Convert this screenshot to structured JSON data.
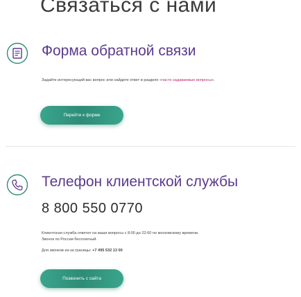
{
  "page_title": "Связаться с нами",
  "feedback": {
    "title": "Форма обратной связи",
    "text_before": "Задайте интересующий вас вопрос или найдите ответ в разделе «",
    "faq_link": "часто задаваемые вопросы",
    "text_after": "».",
    "button": "Перейти к форме"
  },
  "support": {
    "title": "Телефон клиентской службы",
    "phone": "8 800 550 0770",
    "hours_text": "Клиентская служба ответит на ваши вопросы с 8:00 до 22:00 по московскому времени.",
    "free_text": "Звонок по России бесплатный.",
    "abroad_label": "Для звонков из-за границы:",
    "abroad_phone": "+7 495 532 13 00",
    "button": "Позвонить с сайта"
  },
  "colors": {
    "accent": "#5b3b8c",
    "button": "#2e8c77",
    "link": "#c0246f"
  },
  "icons": {
    "feedback": "form-icon",
    "support": "phone-icon"
  }
}
